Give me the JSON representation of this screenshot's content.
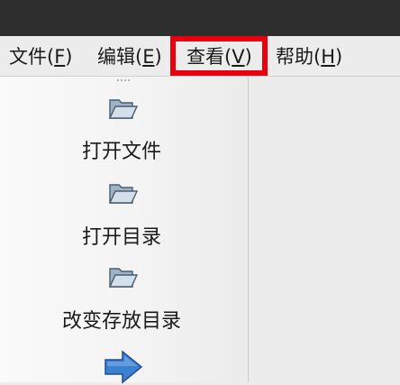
{
  "menubar": {
    "items": [
      {
        "label": "文件(",
        "mnemonic": "F",
        "close": ")"
      },
      {
        "label": "编辑(",
        "mnemonic": "E",
        "close": ")"
      },
      {
        "label": "查看(",
        "mnemonic": "V",
        "close": ")"
      },
      {
        "label": "帮助(",
        "mnemonic": "H",
        "close": ")"
      }
    ]
  },
  "sidebar": {
    "items": [
      {
        "label": "打开文件",
        "icon": "folder-open-icon"
      },
      {
        "label": "打开目录",
        "icon": "folder-open-icon"
      },
      {
        "label": "改变存放目录",
        "icon": "folder-open-icon"
      },
      {
        "label": "",
        "icon": "arrow-right-icon"
      }
    ]
  },
  "colors": {
    "titlebar": "#2e2e2e",
    "highlight": "#e8000f",
    "folder": "#b8c8d6",
    "arrow": "#3d7fd0"
  }
}
